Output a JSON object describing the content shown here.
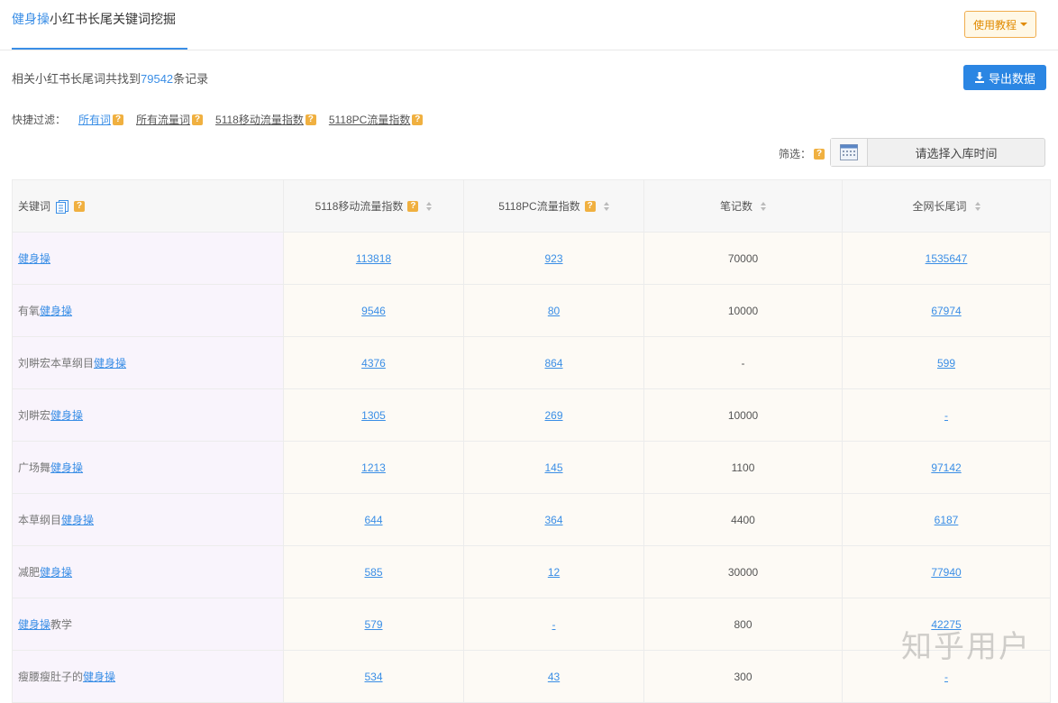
{
  "header": {
    "title_keyword": "健身操",
    "title_rest": "小红书长尾关键词挖掘",
    "tutorial_label": "使用教程"
  },
  "summary": {
    "prefix": "相关小红书长尾词共找到",
    "count": "79542",
    "suffix": "条记录"
  },
  "export_label": "导出数据",
  "quick_filter": {
    "label": "快捷过滤：",
    "items": [
      "所有词",
      "所有流量词",
      "5118移动流量指数",
      "5118PC流量指数"
    ]
  },
  "filter": {
    "label": "筛选：",
    "date_placeholder": "请选择入库时间"
  },
  "table": {
    "columns": [
      "关键词",
      "5118移动流量指数",
      "5118PC流量指数",
      "笔记数",
      "全网长尾词"
    ],
    "rows": [
      {
        "prefix": "",
        "hl": "健身操",
        "suffix": "",
        "mobile": "113818",
        "pc": "923",
        "notes": "70000",
        "longtail": "1535647"
      },
      {
        "prefix": "有氧",
        "hl": "健身操",
        "suffix": "",
        "mobile": "9546",
        "pc": "80",
        "notes": "10000",
        "longtail": "67974"
      },
      {
        "prefix": "刘畊宏本草纲目",
        "hl": "健身操",
        "suffix": "",
        "mobile": "4376",
        "pc": "864",
        "notes": "-",
        "longtail": "599"
      },
      {
        "prefix": "刘畊宏",
        "hl": "健身操",
        "suffix": "",
        "mobile": "1305",
        "pc": "269",
        "notes": "10000",
        "longtail": "-"
      },
      {
        "prefix": "广场舞",
        "hl": "健身操",
        "suffix": "",
        "mobile": "1213",
        "pc": "145",
        "notes": "1100",
        "longtail": "97142"
      },
      {
        "prefix": "本草纲目",
        "hl": "健身操",
        "suffix": "",
        "mobile": "644",
        "pc": "364",
        "notes": "4400",
        "longtail": "6187"
      },
      {
        "prefix": "减肥",
        "hl": "健身操",
        "suffix": "",
        "mobile": "585",
        "pc": "12",
        "notes": "30000",
        "longtail": "77940"
      },
      {
        "prefix": "",
        "hl": "健身操",
        "suffix": "教学",
        "mobile": "579",
        "pc": "-",
        "notes": "800",
        "longtail": "42275"
      },
      {
        "prefix": "瘦腰瘦肚子的",
        "hl": "健身操",
        "suffix": "",
        "mobile": "534",
        "pc": "43",
        "notes": "300",
        "longtail": "-"
      }
    ]
  },
  "watermark": "知乎用户",
  "colors": {
    "accent": "#3a8ee6",
    "help_icon": "#f0b040",
    "export_bg": "#2b86e3",
    "tutorial_border": "#f0ad4e"
  }
}
